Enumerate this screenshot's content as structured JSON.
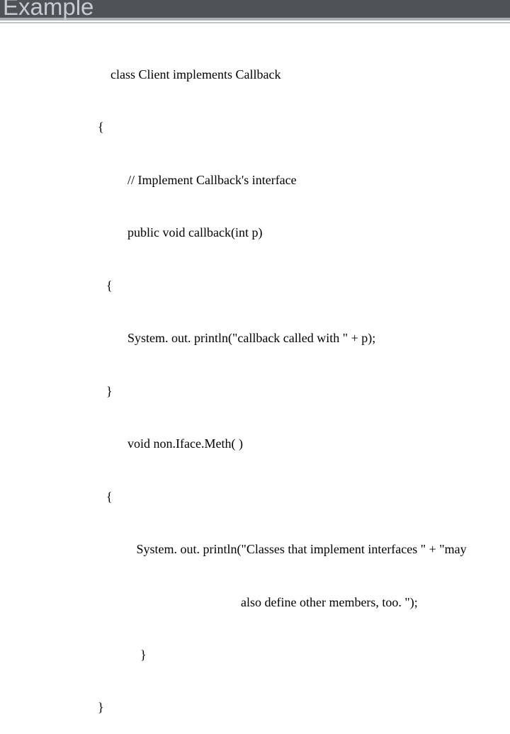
{
  "slide": {
    "title": "Example"
  },
  "code": {
    "l1": "class Client implements Callback",
    "l2": "{",
    "l3": "// Implement Callback's interface",
    "l4": "public void callback(int p)",
    "l5": "{",
    "l6": "System. out. println(\"callback called with \" + p);",
    "l7": "}",
    "l8": "void non.Iface.Meth( )",
    "l9": "{",
    "l10": " System. out. println(\"Classes that implement interfaces \" + \"may",
    "l11": "also define other members, too. \");",
    "l12": "}",
    "l13": "}"
  }
}
